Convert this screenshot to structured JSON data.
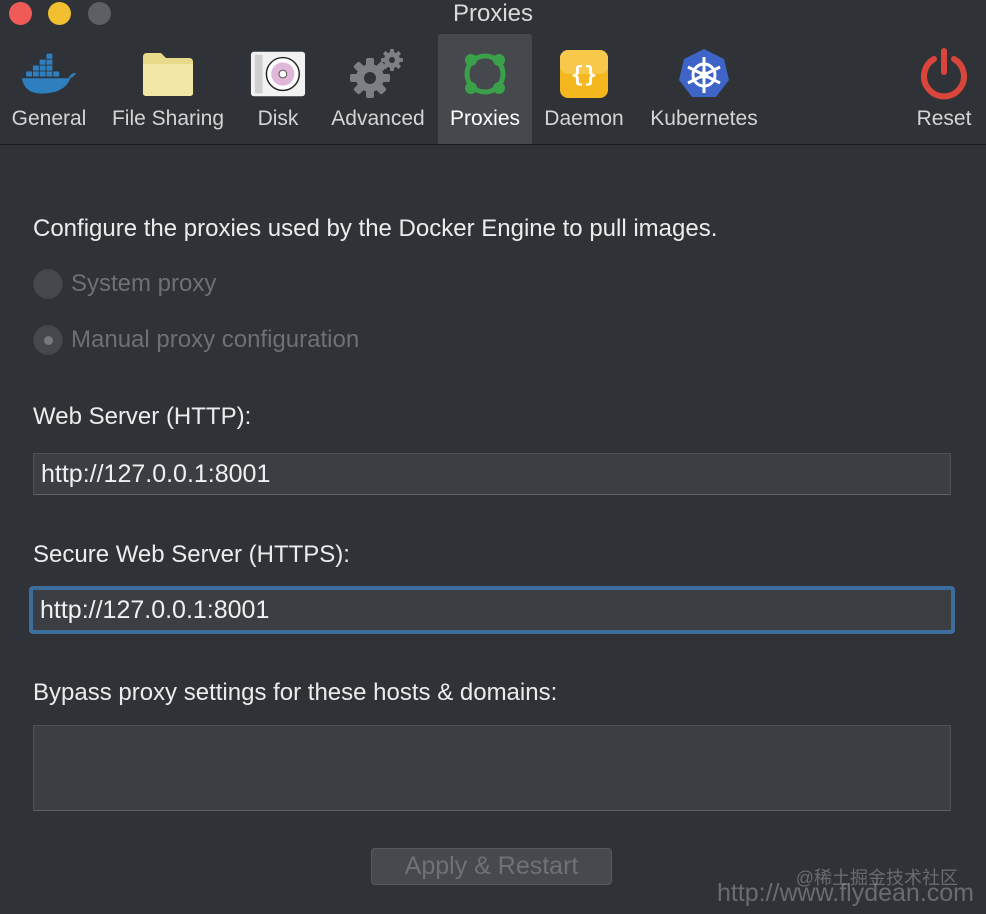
{
  "window": {
    "title": "Proxies"
  },
  "toolbar": {
    "items": [
      {
        "label": "General",
        "icon": "docker-whale-icon"
      },
      {
        "label": "File Sharing",
        "icon": "folder-icon"
      },
      {
        "label": "Disk",
        "icon": "disk-icon"
      },
      {
        "label": "Advanced",
        "icon": "gear-icon"
      },
      {
        "label": "Proxies",
        "icon": "proxies-icon"
      },
      {
        "label": "Daemon",
        "icon": "daemon-braces-icon"
      },
      {
        "label": "Kubernetes",
        "icon": "kubernetes-icon"
      },
      {
        "label": "Reset",
        "icon": "power-icon"
      }
    ],
    "active": "Proxies"
  },
  "proxies": {
    "intro": "Configure the proxies used by the Docker Engine to pull images.",
    "system_proxy_label": "System proxy",
    "manual_proxy_label": "Manual proxy configuration",
    "selected": "Manual proxy configuration",
    "http_label": "Web Server (HTTP):",
    "http_value": "http://127.0.0.1:8001",
    "https_label": "Secure Web Server (HTTPS):",
    "https_value": "http://127.0.0.1:8001",
    "bypass_label": "Bypass proxy settings for these hosts & domains:",
    "bypass_value": "",
    "apply_label": "Apply & Restart"
  },
  "watermark": {
    "line1": "@稀土掘金技术社区",
    "line2": "http://www.flydean.com"
  },
  "colors": {
    "background": "#2f3237",
    "focus_ring": "#3d6d9c",
    "docker_blue": "#2e7fc0",
    "proxies_green": "#3aa14a",
    "daemon_yellow": "#f4b81e",
    "kubernetes_blue": "#3d64c6",
    "reset_red": "#d9453b"
  }
}
